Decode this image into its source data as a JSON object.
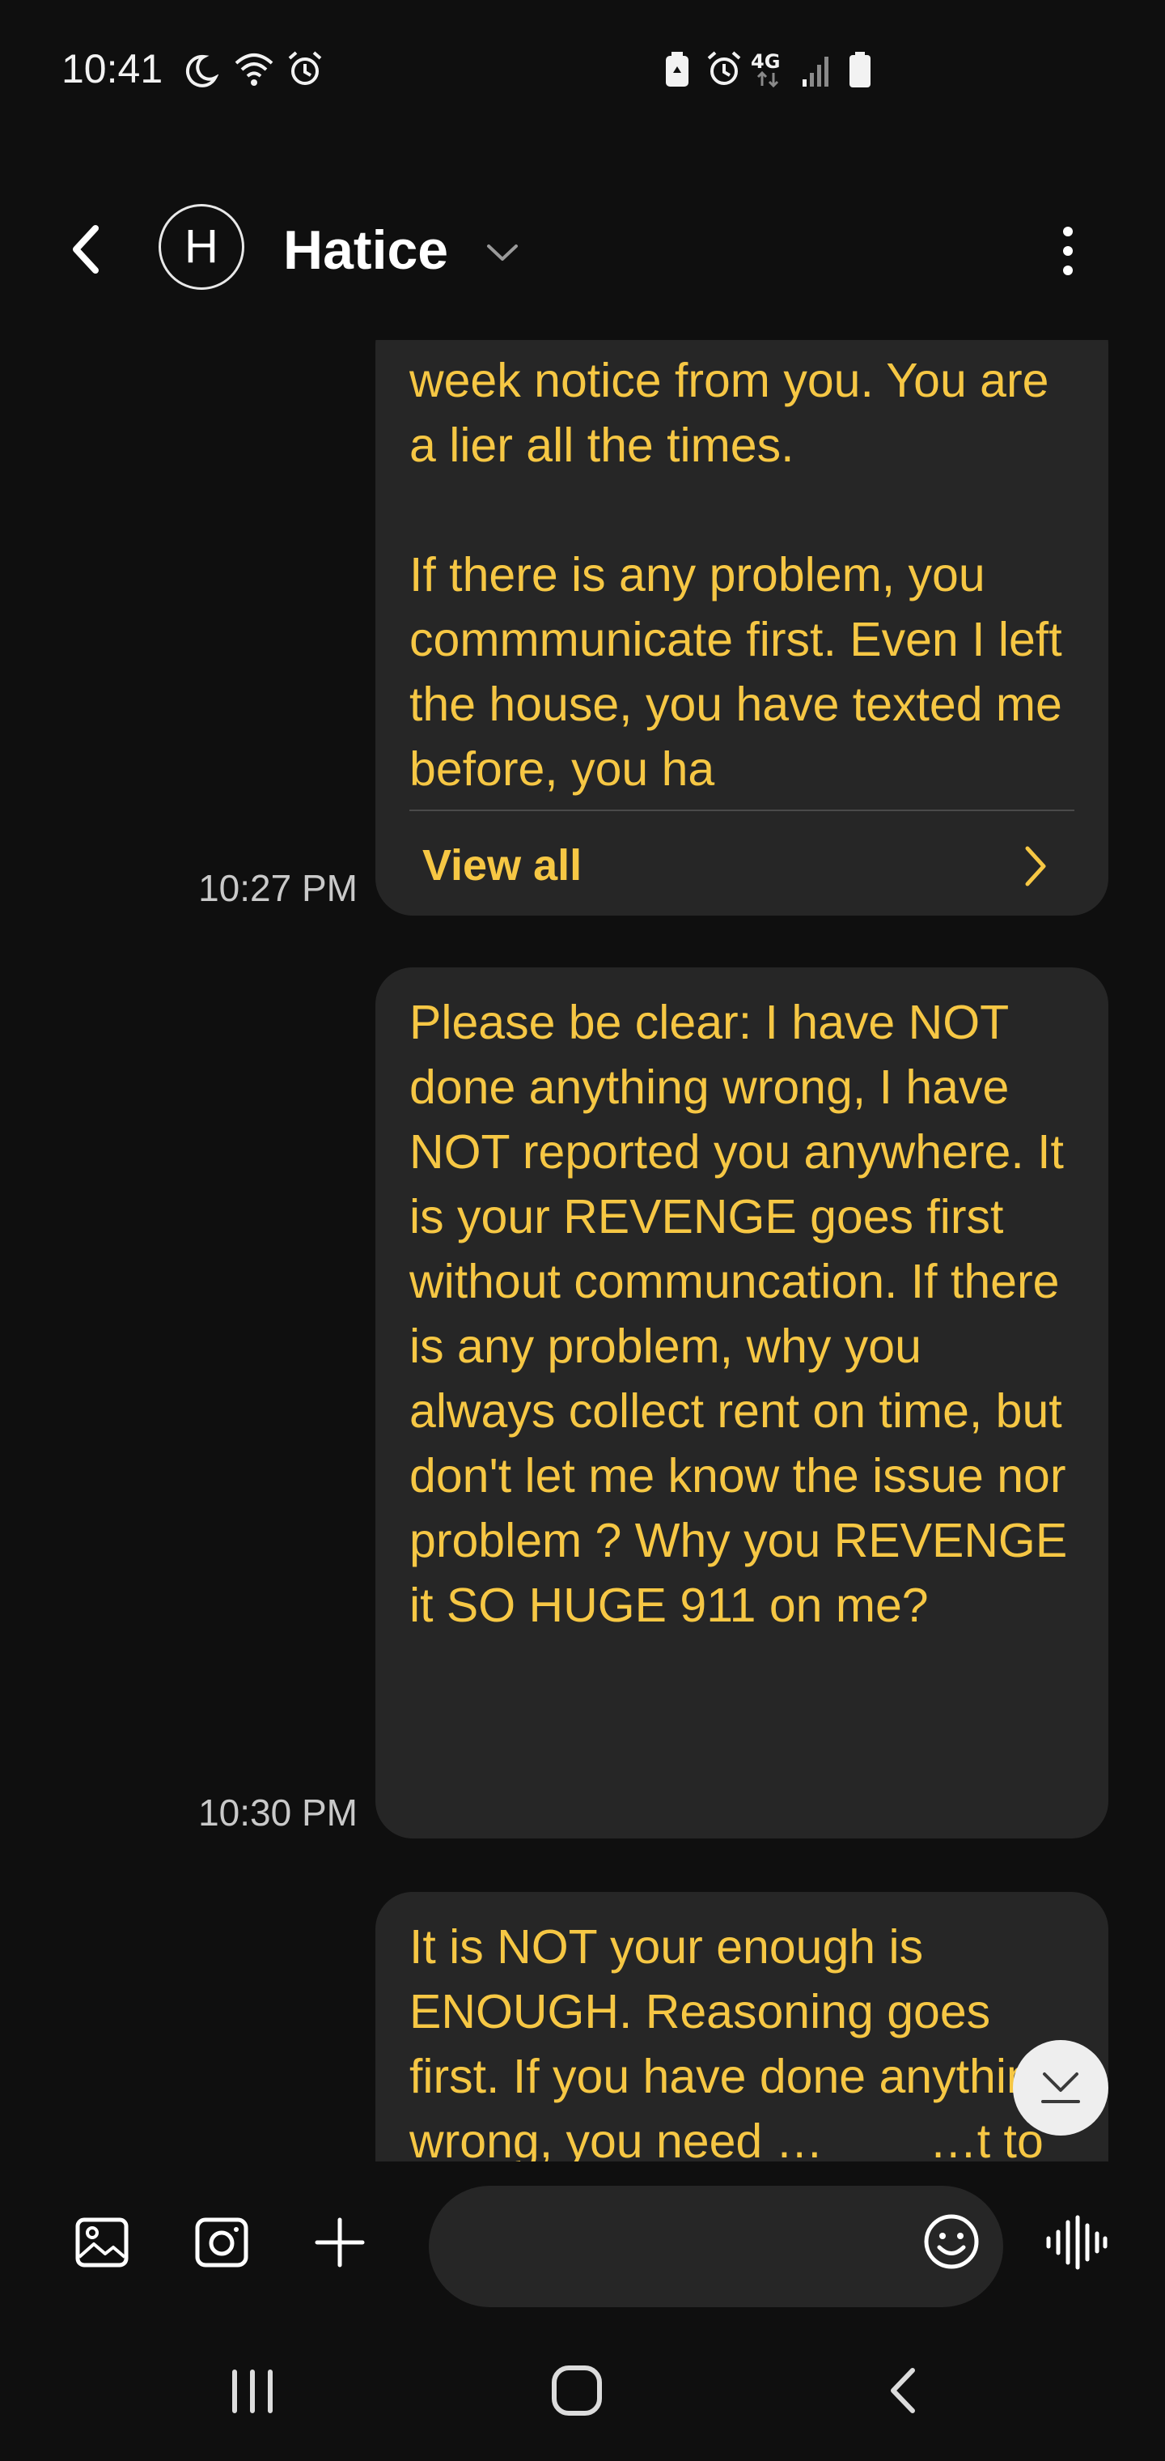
{
  "status_bar": {
    "time": "10:41",
    "left_icons": [
      "moon-icon",
      "wifi-icon",
      "alarm-icon"
    ],
    "right_icons": [
      "battery-saver-icon",
      "alarm-icon",
      "4g-icon",
      "signal-icon",
      "battery-icon"
    ],
    "network_label": "4G"
  },
  "header": {
    "back_icon": "chevron-left-icon",
    "avatar_initial": "H",
    "contact_name": "Hatice",
    "dropdown_icon": "chevron-down-icon",
    "menu_icon": "more-vertical-icon"
  },
  "messages": [
    {
      "text": "week notice from you. You are a lier all the times.\n\nIf there is any problem, you commmunicate first. Even I left the house, you have texted me before, you ha",
      "timestamp": "10:27 PM",
      "view_all_label": "View all"
    },
    {
      "text": "Please be clear: I have NOT done anything wrong, I have NOT reported you anywhere. It is your REVENGE goes first without communcation. If there is any problem, why you always collect rent on time, but don't let me know the issue nor problem ? Why you REVENGE it SO HUGE 911 on me?",
      "timestamp": "10:30 PM"
    },
    {
      "text": "It is NOT your enough is ENOUGH. Reasoning goes first. If you have done anything wrong, you need …        …t to le…                  personality, the lier, the",
      "timestamp": ""
    }
  ],
  "compose": {
    "gallery_icon": "image-icon",
    "camera_icon": "camera-icon",
    "add_icon": "plus-icon",
    "placeholder": "",
    "emoji_icon": "emoji-icon",
    "voice_icon": "voice-waveform-icon"
  },
  "scroll_down_icon": "scroll-to-bottom-icon",
  "nav_bar": {
    "recents_icon": "recents-icon",
    "home_icon": "home-icon",
    "back_icon": "back-icon"
  },
  "colors": {
    "background": "#0f0f0f",
    "bubble": "#262626",
    "message_text": "#f6c744",
    "timestamp": "#c9c9c9"
  }
}
